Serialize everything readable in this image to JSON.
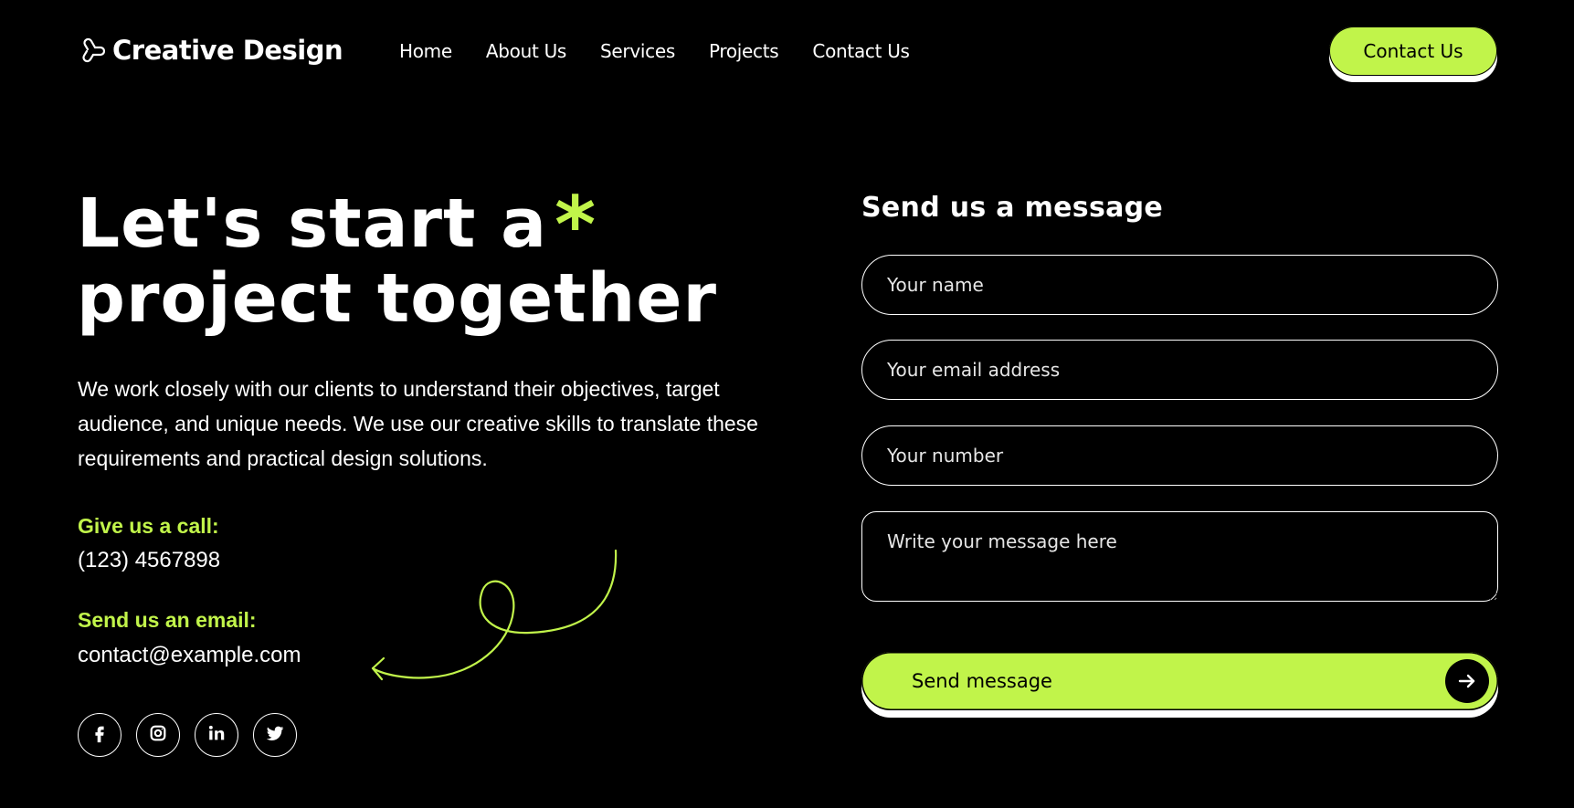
{
  "header": {
    "brand_name": "Creative Design",
    "brand_icon": "pretzel-knot-icon",
    "nav": [
      {
        "label": "Home"
      },
      {
        "label": "About Us"
      },
      {
        "label": "Services"
      },
      {
        "label": "Projects"
      },
      {
        "label": "Contact Us"
      }
    ],
    "cta_label": "Contact Us"
  },
  "hero": {
    "title_line1": "Let's start a",
    "title_asterisk": "*",
    "title_line2": "project together",
    "description": "We work closely with our clients to understand their objectives, target audience, and unique needs. We use our creative skills to translate these requirements and practical design solutions."
  },
  "contact": {
    "call_label": "Give us a call:",
    "call_value": "(123) 4567898",
    "email_label": "Send us an email:",
    "email_value": "contact@example.com"
  },
  "socials": [
    {
      "icon": "facebook-icon"
    },
    {
      "icon": "instagram-icon"
    },
    {
      "icon": "linkedin-icon"
    },
    {
      "icon": "twitter-icon"
    }
  ],
  "form": {
    "title": "Send us a message",
    "name_placeholder": "Your name",
    "email_placeholder": "Your email address",
    "number_placeholder": "Your number",
    "message_placeholder": "Write your message here",
    "submit_label": "Send message"
  },
  "colors": {
    "background": "#000000",
    "accent": "#c1f44a",
    "text": "#ffffff"
  }
}
